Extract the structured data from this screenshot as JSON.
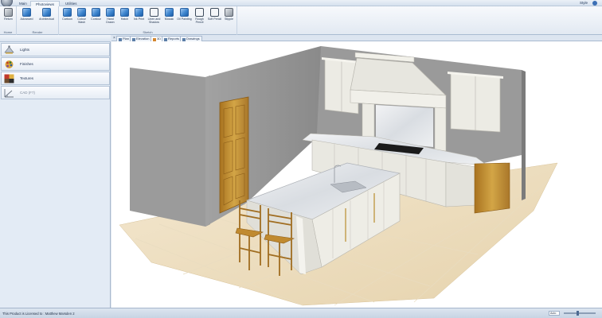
{
  "app": {
    "tabs": [
      {
        "label": "Main"
      },
      {
        "label": "Photoviews"
      },
      {
        "label": "Utilities"
      }
    ],
    "active_tab": "Photoviews",
    "style_menu": "Style"
  },
  "ribbon": {
    "groups": [
      {
        "title": "Home",
        "buttons": [
          "Return"
        ]
      },
      {
        "title": "Render",
        "buttons": [
          "Advanced",
          "Architectual"
        ]
      },
      {
        "title": "Sketch",
        "buttons": [
          "Cartoon",
          "Colour Wash",
          "Contour",
          "Hand Drawn",
          "Hatch",
          "Ink Print",
          "Linen and Shadow",
          "Mosaic",
          "Oil Painting",
          "Rough Pencil",
          "Soft Pencil",
          "Stipple"
        ]
      }
    ]
  },
  "left_panel": {
    "items": [
      {
        "label": "Lights",
        "icon": "lamp-icon"
      },
      {
        "label": "Finishes",
        "icon": "finishes-palette-icon"
      },
      {
        "label": "Textures",
        "icon": "textures-icon"
      },
      {
        "label": "CAD (F7)",
        "icon": "cad-icon",
        "disabled": true
      }
    ]
  },
  "view_tabs": [
    {
      "label": "Plan"
    },
    {
      "label": "Elevation"
    },
    {
      "label": "3D",
      "active": true
    },
    {
      "label": "Reports"
    },
    {
      "label": "Drawings"
    }
  ],
  "status": {
    "license_text": "This Product is Licensed to : Matthew Marsden 2",
    "zoom": "Auto"
  },
  "colors": {
    "ribbon_blue": "#3f86cf",
    "panel_bg": "#e3ebf5",
    "wall_gray": "#8c8c8c",
    "cabinet_cream": "#ecebe4",
    "oak": "#c89a38"
  }
}
